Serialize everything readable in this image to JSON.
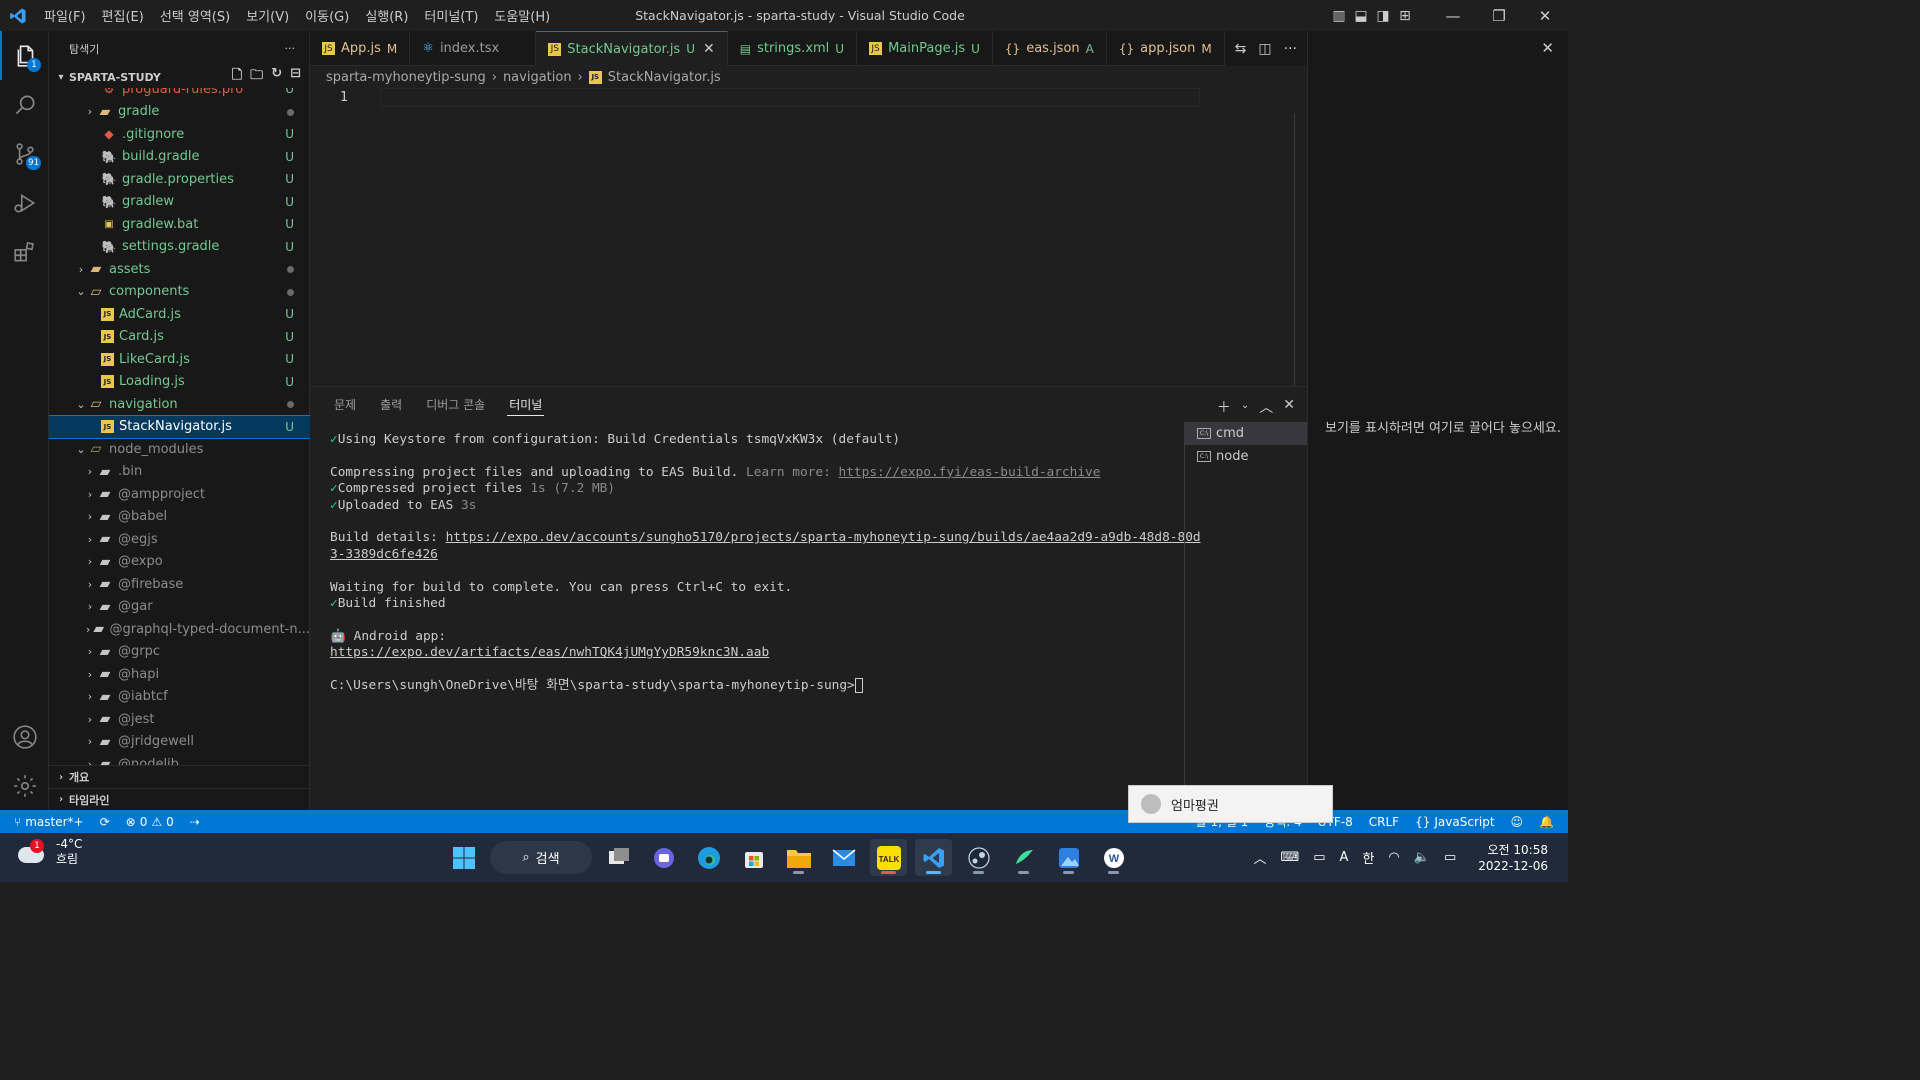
{
  "window": {
    "title": "StackNavigator.js - sparta-study - Visual Studio Code",
    "menu": [
      "파일(F)",
      "편집(E)",
      "선택 영역(S)",
      "보기(V)",
      "이동(G)",
      "실행(R)",
      "터미널(T)",
      "도움말(H)"
    ]
  },
  "activity": {
    "explorer_badge": "1",
    "scm_badge": "91"
  },
  "sidebar": {
    "header": "탐색기",
    "more": "···",
    "section": "SPARTA-STUDY",
    "items": [
      {
        "label": "proguard-rules.pro",
        "status": "U",
        "icon": "file"
      },
      {
        "label": "gradle",
        "status": "•",
        "icon": "folder"
      },
      {
        "label": ".gitignore",
        "status": "U",
        "icon": "git"
      },
      {
        "label": "build.gradle",
        "status": "U",
        "icon": "gradle"
      },
      {
        "label": "gradle.properties",
        "status": "U",
        "icon": "gradle"
      },
      {
        "label": "gradlew",
        "status": "U",
        "icon": "gradle"
      },
      {
        "label": "gradlew.bat",
        "status": "U",
        "icon": "bat"
      },
      {
        "label": "settings.gradle",
        "status": "U",
        "icon": "gradle"
      },
      {
        "label": "assets",
        "status": "•",
        "icon": "folder"
      },
      {
        "label": "components",
        "status": "•",
        "icon": "folder-open"
      },
      {
        "label": "AdCard.js",
        "status": "U",
        "icon": "js"
      },
      {
        "label": "Card.js",
        "status": "U",
        "icon": "js"
      },
      {
        "label": "LikeCard.js",
        "status": "U",
        "icon": "js"
      },
      {
        "label": "Loading.js",
        "status": "U",
        "icon": "js"
      },
      {
        "label": "navigation",
        "status": "•",
        "icon": "folder-open"
      },
      {
        "label": "StackNavigator.js",
        "status": "U",
        "icon": "js"
      },
      {
        "label": "node_modules",
        "status": "",
        "icon": "folder-open"
      },
      {
        "label": ".bin",
        "status": "",
        "icon": "folder"
      },
      {
        "label": "@ampproject",
        "status": "",
        "icon": "folder"
      },
      {
        "label": "@babel",
        "status": "",
        "icon": "folder"
      },
      {
        "label": "@egjs",
        "status": "",
        "icon": "folder"
      },
      {
        "label": "@expo",
        "status": "",
        "icon": "folder"
      },
      {
        "label": "@firebase",
        "status": "",
        "icon": "folder"
      },
      {
        "label": "@gar",
        "status": "",
        "icon": "folder"
      },
      {
        "label": "@graphql-typed-document-n...",
        "status": "",
        "icon": "folder"
      },
      {
        "label": "@grpc",
        "status": "",
        "icon": "folder"
      },
      {
        "label": "@hapi",
        "status": "",
        "icon": "folder"
      },
      {
        "label": "@iabtcf",
        "status": "",
        "icon": "folder"
      },
      {
        "label": "@jest",
        "status": "",
        "icon": "folder"
      },
      {
        "label": "@jridgewell",
        "status": "",
        "icon": "folder"
      },
      {
        "label": "@nodelib",
        "status": "",
        "icon": "folder"
      }
    ],
    "outline": "개요",
    "timeline": "타임라인"
  },
  "tabs": [
    {
      "label": "App.js",
      "mark": "M",
      "icon": "JS"
    },
    {
      "label": "index.tsx",
      "mark": "",
      "icon": "⚛"
    },
    {
      "label": "StackNavigator.js",
      "mark": "U",
      "icon": "JS"
    },
    {
      "label": "strings.xml",
      "mark": "U",
      "icon": "▤"
    },
    {
      "label": "MainPage.js",
      "mark": "U",
      "icon": "JS"
    },
    {
      "label": "eas.json",
      "mark": "A",
      "icon": "{}"
    },
    {
      "label": "app.json",
      "mark": "M",
      "icon": "{}"
    }
  ],
  "breadcrumb": [
    "sparta-myhoneytip-sung",
    "navigation",
    "StackNavigator.js"
  ],
  "editor": {
    "line": "1"
  },
  "panel": {
    "tabs": [
      "문제",
      "출력",
      "디버그 콘솔",
      "터미널"
    ],
    "terminals": [
      "cmd",
      "node"
    ],
    "lines": {
      "l1": "Using Keystore from configuration: Build Credentials tsmqVxKW3x (default)",
      "l2a": "Compressing project files and uploading to EAS Build. ",
      "l2b": "Learn more: ",
      "l2c": "https://expo.fyi/eas-build-archive",
      "l3a": "Compressed project files ",
      "l3b": "1s (7.2 MB)",
      "l4a": "Uploaded to EAS ",
      "l4b": "3s",
      "l5a": "Build details: ",
      "l5b": "https://expo.dev/accounts/sungho5170/projects/sparta-myhoneytip-sung/builds/ae4aa2d9-a9db-48d8-80d",
      "l5c": "3-3389dc6fe426",
      "l6": "Waiting for build to complete. You can press Ctrl+C to exit.",
      "l7": "Build finished",
      "l8": "Android app:",
      "l9": "https://expo.dev/artifacts/eas/nwhTQK4jUMgYyDR59knc3N.aab",
      "l10": "C:\\Users\\sungh\\OneDrive\\바탕 화면\\sparta-study\\sparta-myhoneytip-sung>"
    }
  },
  "aux": {
    "hint": "보기를 표시하려면 여기로 끌어다 놓으세요."
  },
  "toast": {
    "name": "엄마평권"
  },
  "statusbar": {
    "branch": "master*+",
    "errors": "0",
    "warnings": "0",
    "position": "줄 1, 열 1",
    "spaces": "공백: 4",
    "encoding": "UTF-8",
    "eol": "CRLF",
    "language": "JavaScript"
  },
  "taskbar": {
    "weather_temp": "-4°C",
    "weather_desc": "흐림",
    "weather_badge": "1",
    "search": "검색",
    "time": "오전 10:58",
    "date": "2022-12-06",
    "ime_a": "A",
    "ime_han": "한"
  },
  "colors": {
    "accent": "#0078d4",
    "statusbar": "#0078d4",
    "untracked": "#73c991"
  }
}
